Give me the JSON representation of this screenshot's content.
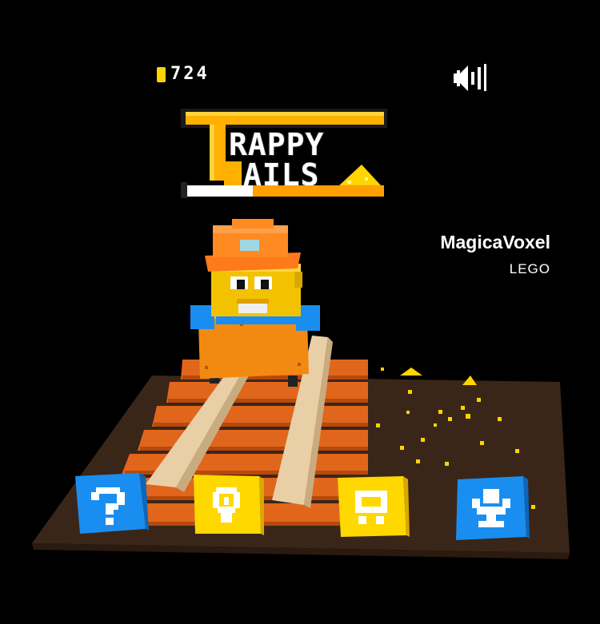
{
  "hud": {
    "coin_count": "724",
    "coin_icon": "coin-icon",
    "sound_icon": "speaker-icon"
  },
  "logo": {
    "line1": "RAPPY",
    "line2": "AILS",
    "letter_t": "T",
    "letter_r": "R"
  },
  "credits": {
    "tool": "MagicaVoxel",
    "sub": "LEGO"
  },
  "menu": {
    "buttons": [
      {
        "name": "help",
        "icon": "question-mark-icon",
        "color": "#1a8ef0"
      },
      {
        "name": "hint",
        "icon": "lightbulb-icon",
        "color": "#ffd800"
      },
      {
        "name": "shop",
        "icon": "cart-icon",
        "color": "#ffd800"
      },
      {
        "name": "leaderboard",
        "icon": "trophy-icon",
        "color": "#1a8ef0"
      }
    ]
  },
  "colors": {
    "background": "#000000",
    "gold": "#ffd400",
    "orange": "#ff9900",
    "blue": "#1a8ef0",
    "dirt": "#3a2618",
    "tie": "#e0661c",
    "rail": "#e8cfa6"
  }
}
